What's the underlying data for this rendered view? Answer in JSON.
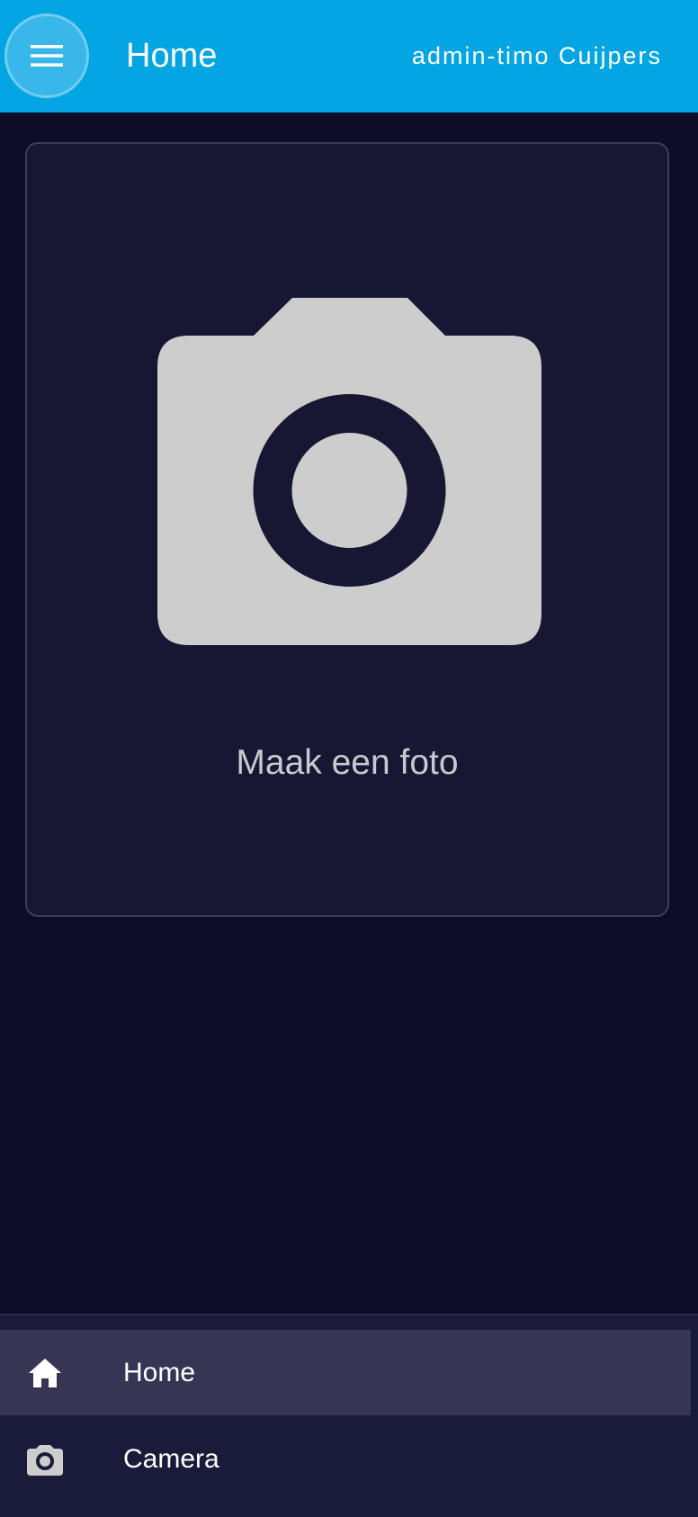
{
  "appbar": {
    "title": "Home",
    "user": "admin-timo Cuijpers",
    "menu_icon": "hamburger-icon",
    "color": "#03a5e3"
  },
  "card": {
    "icon": "camera-icon",
    "caption": "Maak een foto"
  },
  "nav": {
    "items": [
      {
        "label": "Home",
        "icon": "home-icon",
        "active": true
      },
      {
        "label": "Camera",
        "icon": "camera-icon",
        "active": false
      }
    ]
  }
}
